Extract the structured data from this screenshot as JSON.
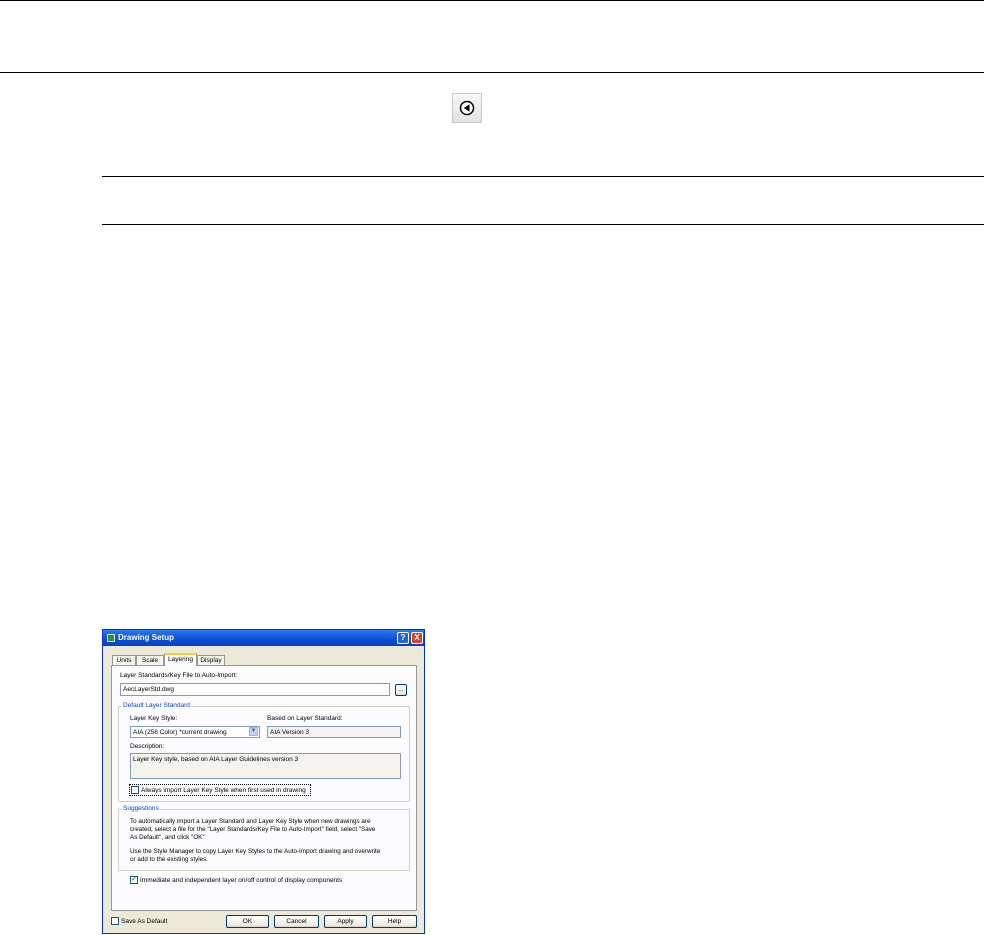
{
  "nav": {
    "prev_icon": "previous-arrow-icon"
  },
  "dialog": {
    "title": "Drawing Setup",
    "help_label": "?",
    "close_label": "X",
    "tabs": [
      {
        "label": "Units",
        "active": false
      },
      {
        "label": "Scale",
        "active": false
      },
      {
        "label": "Layering",
        "active": true
      },
      {
        "label": "Display",
        "active": false
      }
    ],
    "file_label": "Layer Standards/Key File to Auto-Import:",
    "file_value": "AecLayerStd.dwg",
    "browse_label": "...",
    "default_group": {
      "legend": "Default Layer Standard",
      "key_style_label": "Layer Key Style:",
      "key_style_value": "AIA (256 Color) *current drawing",
      "based_on_label": "Based on Layer Standard:",
      "based_on_value": "AIA Version 3",
      "description_label": "Description:",
      "description_value": "Layer Key style, based on AIA Layer Guidelines version 3",
      "always_import_label": "Always import Layer Key Style when first used in drawing",
      "always_import_checked": false
    },
    "suggestions": {
      "legend": "Suggestions",
      "line1": "To automatically import a Layer Standard and Layer Key Style when new drawings are",
      "line2": "created, select a file for the \"Layer Standards/Key File to Auto-Import\" field, select \"Save",
      "line3": "As Default\", and click \"OK\"",
      "line4": "Use the Style Manager to copy Layer Key Styles to the Auto-Import drawing and overwrite",
      "line5": "or add to the existing styles."
    },
    "immediate_label": "Immediate and independent layer on/off control of display components",
    "immediate_checked": true,
    "checkmark": "✓",
    "save_default_label": "Save As Default",
    "buttons": {
      "ok": "OK",
      "cancel": "Cancel",
      "apply": "Apply",
      "help": "Help"
    }
  }
}
